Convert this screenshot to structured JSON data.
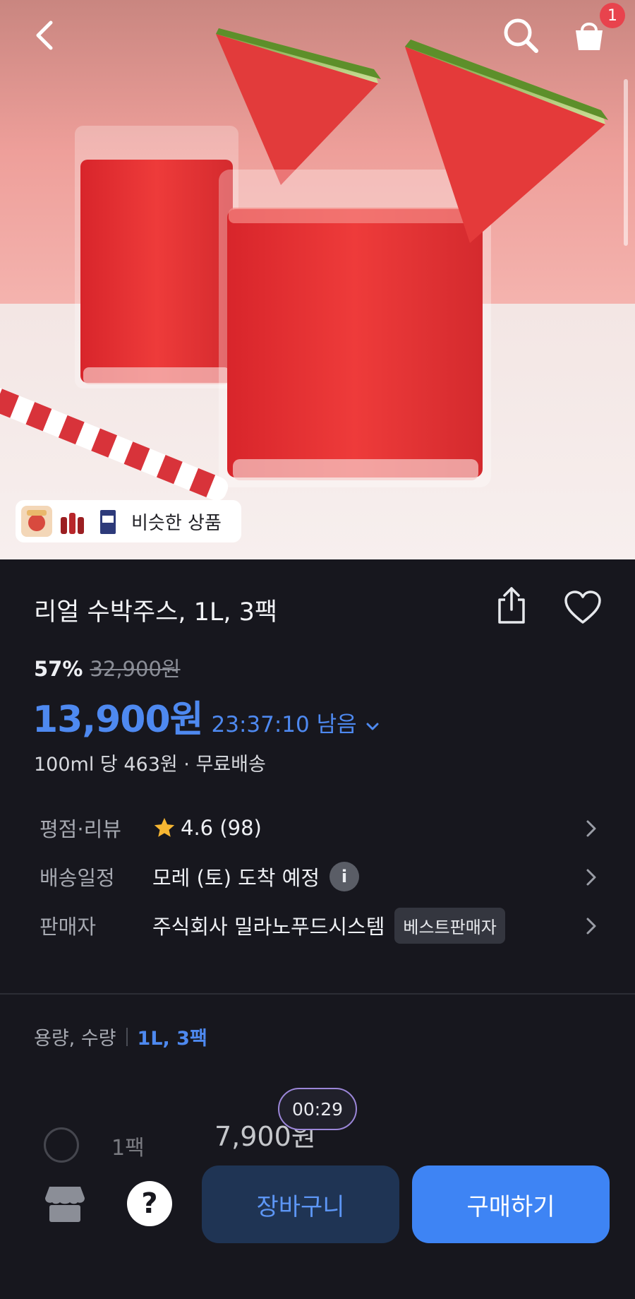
{
  "header": {
    "back_icon": "chevron-left-icon",
    "search_icon": "search-icon",
    "cart_icon": "shopping-bag-icon",
    "cart_count": "1"
  },
  "hero": {
    "similar_label": "비슷한 상품"
  },
  "product": {
    "title": "리얼 수박주스, 1L, 3팩",
    "discount": "57%",
    "original_price": "32,900원",
    "price": "13,900원",
    "timer_text": "23:37:10 남음",
    "unit_price": "100ml 당 463원 · 무료배송"
  },
  "specs": {
    "rating_label": "평점·리뷰",
    "rating_value": "4.6 (98)",
    "delivery_label": "배송일정",
    "delivery_value": "모레 (토) 도착 예정",
    "seller_label": "판매자",
    "seller_value": "주식회사 밀라노푸드시스템",
    "seller_badge": "베스트판매자"
  },
  "option": {
    "label": "용량, 수량",
    "value": "1L, 3팩"
  },
  "faded_option": {
    "pack": "1팩",
    "price": "7,900원",
    "timer": "00:29"
  },
  "bottom_bar": {
    "cart_button": "장바구니",
    "buy_button": "구매하기",
    "help_glyph": "?"
  },
  "colors": {
    "accent": "#4e89f0",
    "background": "#17171e",
    "badge": "#e8434d"
  }
}
